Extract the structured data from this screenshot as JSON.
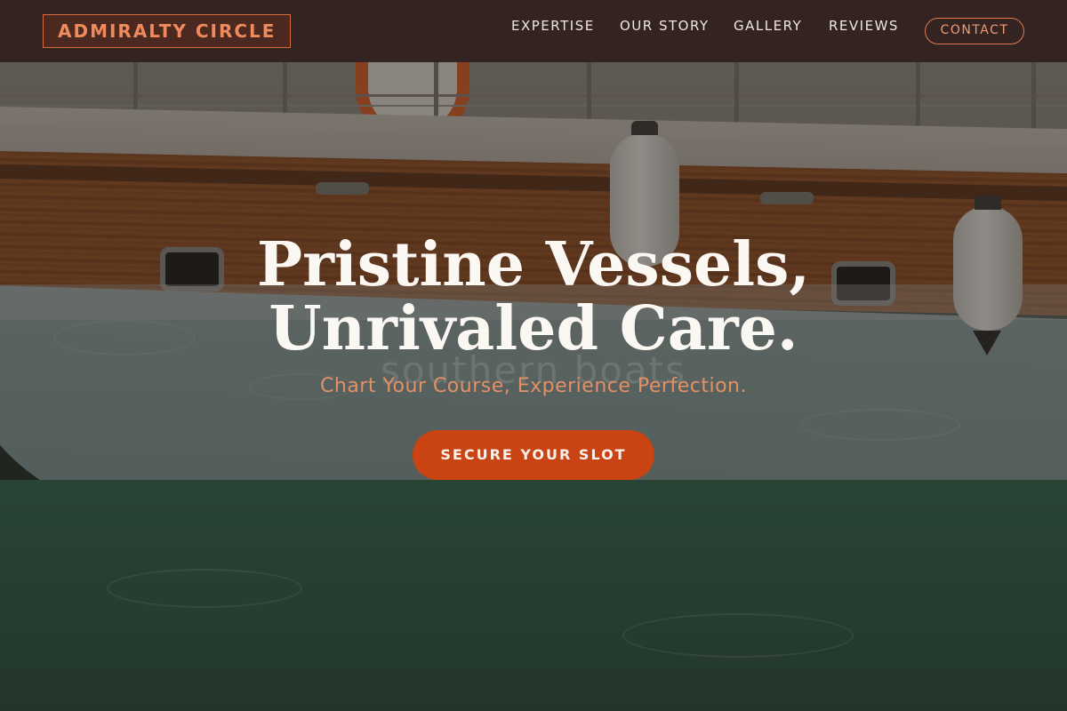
{
  "brand": {
    "logo_text": "ADMIRALTY CIRCLE"
  },
  "nav": {
    "items": [
      {
        "label": "EXPERTISE"
      },
      {
        "label": "OUR STORY"
      },
      {
        "label": "GALLERY"
      },
      {
        "label": "REVIEWS"
      }
    ],
    "contact_label": "CONTACT"
  },
  "hero": {
    "title_line1": "Pristine Vessels,",
    "title_line2": "Unrivaled Care.",
    "subtitle": "Chart Your Course, Experience Perfection.",
    "cta_label": "SECURE YOUR SLOT",
    "background_watermark": "southern boats"
  },
  "colors": {
    "accent": "#c94412",
    "accent_light": "#e58f66",
    "header_bg": "#30201e",
    "text_light": "#fbf7f2"
  }
}
